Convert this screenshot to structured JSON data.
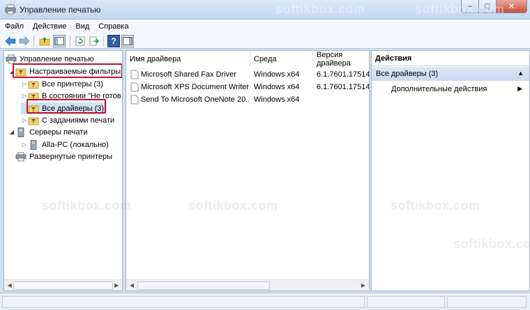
{
  "window": {
    "title": "Управление печатью"
  },
  "menu": [
    {
      "label": "Файл"
    },
    {
      "label": "Действие"
    },
    {
      "label": "Вид"
    },
    {
      "label": "Справка"
    }
  ],
  "tree": {
    "root": "Управление печатью",
    "custom_filters": "Настраиваемые фильтры",
    "all_printers": "Все принтеры (3)",
    "not_ready": "В состоянии \"Не готов",
    "all_drivers": "Все драйверы (3)",
    "with_jobs": "С заданиями печати",
    "print_servers": "Серверы печати",
    "local_pc": "Alla-PC (локально)",
    "deployed_printers": "Развернутые принтеры"
  },
  "list": {
    "columns": [
      "Имя драйвера",
      "Среда",
      "Версия драйвера"
    ],
    "rows": [
      {
        "name": "Microsoft Shared Fax Driver",
        "env": "Windows x64",
        "version": "6.1.7601.17514"
      },
      {
        "name": "Microsoft XPS Document Writer",
        "env": "Windows x64",
        "version": "6.1.7601.17514"
      },
      {
        "name": "Send To Microsoft OneNote 20...",
        "env": "Windows x64",
        "version": ""
      }
    ]
  },
  "actions": {
    "header": "Действия",
    "section": "Все драйверы (3)",
    "item": "Дополнительные действия"
  },
  "watermark": "softikbox.com",
  "colors": {
    "highlight": "#c8102e",
    "selection": "#cfe0f3"
  }
}
